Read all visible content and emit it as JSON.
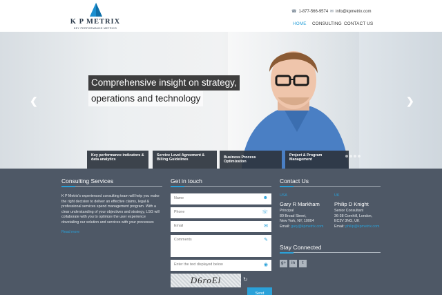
{
  "brand": {
    "name": "K P METRIX",
    "tagline": "KEY PERFORMANCE METRICS",
    "accent": "#2aa1d9"
  },
  "header": {
    "phone": "1-877-566-9574",
    "email": "info@kpmetrix.com",
    "nav": [
      "HOME",
      "CONSULTING",
      "CONTACT US"
    ],
    "active_nav": "HOME"
  },
  "hero": {
    "headline_line1": "Comprehensive insight on strategy,",
    "headline_line2": "operations and technology",
    "tabs": [
      "Key performance indicators & data analytics",
      "Service Level Agreement & Billing Guidelines",
      "Business Process Optimization",
      "Project & Program Management"
    ],
    "prev_icon": "chevron-left-icon",
    "next_icon": "chevron-right-icon"
  },
  "consulting": {
    "title": "Consulting Services",
    "body": "K P Metrix's experienced consulting team will help you make the right decision to deliver an effective claims, legal & professional services spend management program. With a clear understanding of your objectives and strategy, LSG will collaborate with you to optimize the user experience dovetailing our solution and services with your processes",
    "read_more": "Read more"
  },
  "form": {
    "title": "Get in touch",
    "name_placeholder": "Name",
    "phone_placeholder": "Phone",
    "email_placeholder": "Email",
    "comments_placeholder": "Comments",
    "captcha_placeholder": "Enter the text displayed below",
    "captcha_text": "D6roEl",
    "send_label": "Send"
  },
  "contact": {
    "title": "Contact Us",
    "people": [
      {
        "location": "USA",
        "name": "Gary R Markham",
        "role": "Principal",
        "address1": "80 Broad Street,",
        "address2": "New York, NY, 10004",
        "email_label": "Email:",
        "email": "gary@kpmetrix.com"
      },
      {
        "location": "UK",
        "name": "Philip D Knight",
        "role": "Senior Consultant",
        "address1": "36-38 Cornhill, London,",
        "address2": "EC3V 3NG, UK",
        "email_label": "Email:",
        "email": "philip@kpmetrix.com"
      }
    ]
  },
  "connected": {
    "title": "Stay Connected",
    "icons": [
      "google-plus-icon",
      "linkedin-icon",
      "twitter-icon"
    ]
  }
}
